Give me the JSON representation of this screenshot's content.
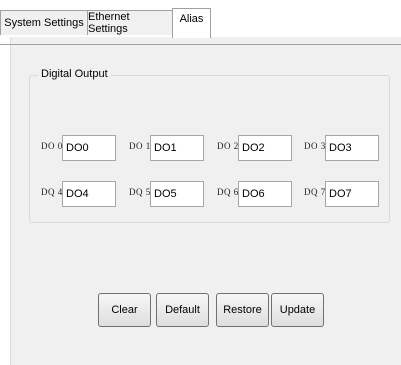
{
  "tabs": [
    {
      "label": "System Settings",
      "active": false
    },
    {
      "label": "Ethernet Settings",
      "active": false
    },
    {
      "label": "Alias",
      "active": true
    }
  ],
  "group": {
    "title": "Digital Output",
    "fields": [
      {
        "label": "DO 0",
        "value": "DO0"
      },
      {
        "label": "DO 1",
        "value": "DO1"
      },
      {
        "label": "DO 2",
        "value": "DO2"
      },
      {
        "label": "DO 3",
        "value": "DO3"
      },
      {
        "label": "DQ 4",
        "value": "DO4"
      },
      {
        "label": "DQ 5",
        "value": "DO5"
      },
      {
        "label": "DQ 6",
        "value": "DO6"
      },
      {
        "label": "DQ 7",
        "value": "DO7"
      }
    ]
  },
  "buttons": {
    "clear": "Clear",
    "default": "Default",
    "restore": "Restore",
    "update": "Update"
  }
}
